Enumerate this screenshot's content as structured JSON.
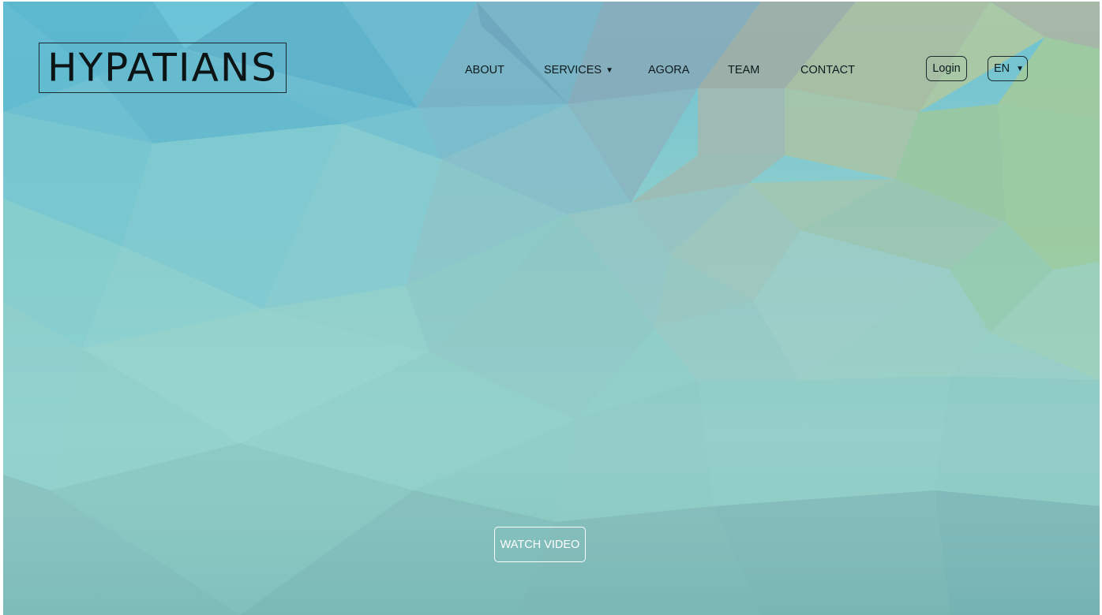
{
  "brand": {
    "logo_text": "HYPATIANS"
  },
  "nav": {
    "items": [
      {
        "label": "ABOUT",
        "has_dropdown": false
      },
      {
        "label": "SERVICES",
        "has_dropdown": true,
        "caret": "▼"
      },
      {
        "label": "AGORA",
        "has_dropdown": false
      },
      {
        "label": "TEAM",
        "has_dropdown": false
      },
      {
        "label": "CONTACT",
        "has_dropdown": false
      }
    ]
  },
  "header": {
    "login_label": "Login",
    "language": {
      "selected": "EN",
      "caret": "▼"
    }
  },
  "hero": {
    "watch_video_label": "WATCH VIDEO",
    "background": {
      "style": "low-poly gradient",
      "colors": [
        "#5fb8cf",
        "#8ed2d0",
        "#8ecdc6",
        "#a9c49b",
        "#7fb9b7"
      ]
    }
  }
}
